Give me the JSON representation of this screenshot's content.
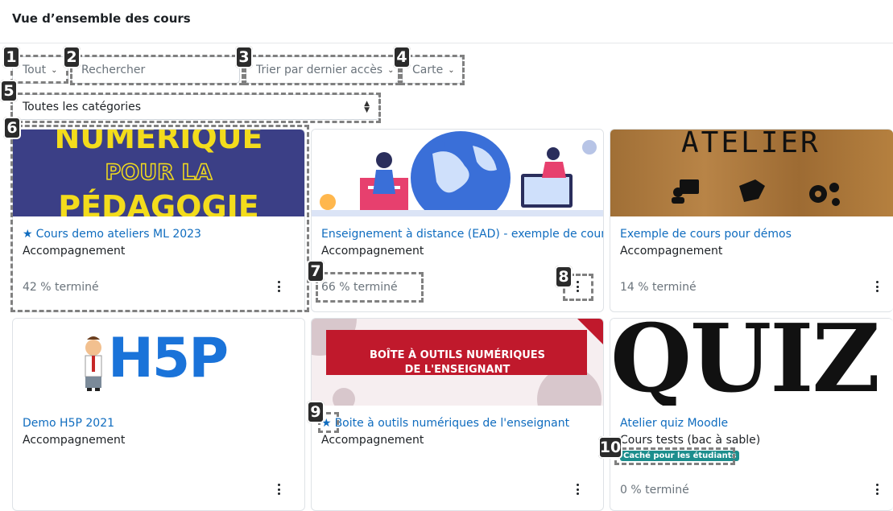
{
  "page": {
    "title": "Vue d’ensemble des cours"
  },
  "filters": {
    "grouping": "Tout",
    "search_placeholder": "Rechercher",
    "sort": "Trier par dernier accès",
    "view": "Carte",
    "category": "Toutes les catégories"
  },
  "annotations": [
    "1",
    "2",
    "3",
    "4",
    "5",
    "6",
    "7",
    "8",
    "9",
    "10"
  ],
  "cards": [
    {
      "title": "Cours demo ateliers ML 2023",
      "category": "Accompagnement",
      "progress": "42 % terminé",
      "starred": true,
      "image_lines": [
        "NUMÉRIQUE",
        "POUR LA",
        "PÉDAGOGIE"
      ]
    },
    {
      "title": "Enseignement à distance (EAD) - exemple de cours",
      "category": "Accompagnement",
      "progress": "66 % terminé",
      "starred": false
    },
    {
      "title": "Exemple de cours pour démos",
      "category": "Accompagnement",
      "progress": "14 % terminé",
      "starred": false,
      "image_text": "ATELIER"
    },
    {
      "title": "Demo H5P 2021",
      "category": "Accompagnement",
      "progress": "",
      "starred": false,
      "image_text": "H5P"
    },
    {
      "title": "Boite à outils numériques de l'enseignant",
      "category": "Accompagnement",
      "progress": "",
      "starred": true,
      "image_lines": [
        "BOÎTE À OUTILS NUMÉRIQUES",
        "DE L'ENSEIGNANT"
      ]
    },
    {
      "title": "Atelier quiz Moodle",
      "category": "Cours tests (bac à sable)",
      "progress": "0 % terminé",
      "starred": false,
      "badge": "Caché pour les étudiants",
      "image_text": "QUIZ"
    }
  ],
  "colors": {
    "link": "#0f6cbf",
    "badge": "#1c8e8d",
    "banner1_bg": "#3b3f86",
    "banner1_text": "#f3dc1c",
    "banner5_red": "#c0192c",
    "wood": "#a9763c"
  }
}
